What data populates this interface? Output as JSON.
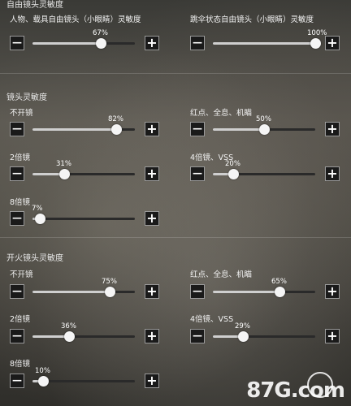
{
  "sections": {
    "free_look": {
      "title": "自由镜头灵敏度"
    },
    "scope": {
      "title": "镜头灵敏度"
    },
    "fire": {
      "title": "开火镜头灵敏度"
    }
  },
  "sliders": {
    "free_char": {
      "label": "人物、载具自由镜头（小眼睛）灵敏度",
      "value_text": "67%",
      "value": 0.67
    },
    "free_para": {
      "label": "跳伞状态自由镜头（小眼睛）灵敏度",
      "value_text": "100%",
      "value": 1.0
    },
    "scope_none": {
      "label": "不开镜",
      "value_text": "82%",
      "value": 0.82
    },
    "scope_red": {
      "label": "红点、全息、机瞄",
      "value_text": "50%",
      "value": 0.5
    },
    "scope_2x": {
      "label": "2倍镜",
      "value_text": "31%",
      "value": 0.31
    },
    "scope_4x": {
      "label": "4倍镜、VSS",
      "value_text": "20%",
      "value": 0.2
    },
    "scope_8x": {
      "label": "8倍镜",
      "value_text": "7%",
      "value": 0.07
    },
    "fire_none": {
      "label": "不开镜",
      "value_text": "75%",
      "value": 0.75
    },
    "fire_red": {
      "label": "红点、全息、机瞄",
      "value_text": "65%",
      "value": 0.65
    },
    "fire_2x": {
      "label": "2倍镜",
      "value_text": "36%",
      "value": 0.36
    },
    "fire_4x": {
      "label": "4倍镜、VSS",
      "value_text": "29%",
      "value": 0.29
    },
    "fire_8x": {
      "label": "8倍镜",
      "value_text": "10%",
      "value": 0.1
    }
  },
  "buttons": {
    "minus": "—",
    "plus": "+"
  },
  "watermark": {
    "text": "87G.com"
  },
  "icons": {
    "minus": "minus-icon",
    "plus": "plus-icon"
  },
  "colors": {
    "fill": "#cfcfcf",
    "knob": "#f5f5f5",
    "button_bg": "#1a1a1a"
  }
}
